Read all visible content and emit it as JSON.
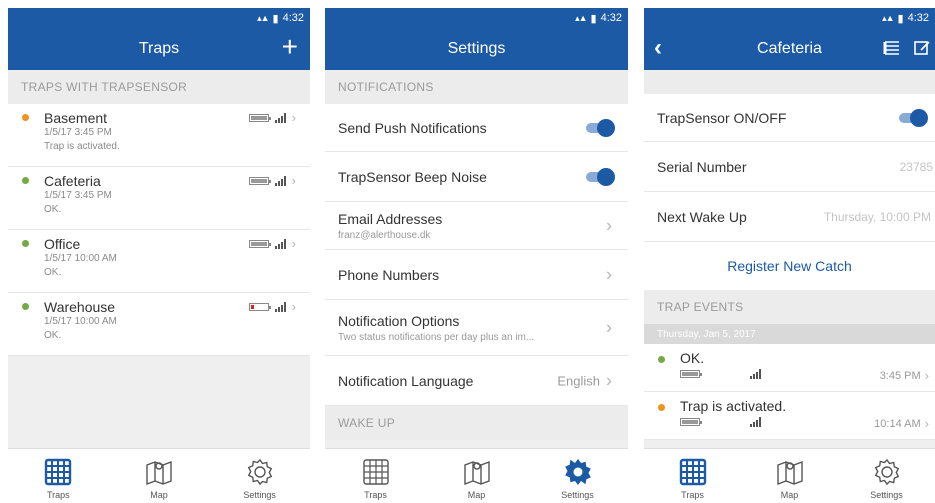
{
  "colors": {
    "primary": "#1d5aa6",
    "dot_orange": "#f0921c",
    "dot_green": "#74aa42",
    "battery_low": "#e02020"
  },
  "status_bar": {
    "time": "4:32"
  },
  "screen1": {
    "title": "Traps",
    "add_icon": "plus-icon",
    "section": "TRAPS WITH TRAPSENSOR",
    "traps": [
      {
        "name": "Basement",
        "time": "1/5/17 3:45 PM",
        "status": "Trap is activated.",
        "dot": "orange",
        "battery": 0.9
      },
      {
        "name": "Cafeteria",
        "time": "1/5/17 3:45 PM",
        "status": "OK.",
        "dot": "green",
        "battery": 0.9
      },
      {
        "name": "Office",
        "time": "1/5/17 10:00 AM",
        "status": "OK.",
        "dot": "green",
        "battery": 0.9
      },
      {
        "name": "Warehouse",
        "time": "1/5/17 10:00 AM",
        "status": "OK.",
        "dot": "green",
        "battery": 0.15
      }
    ]
  },
  "screen2": {
    "title": "Settings",
    "section_notifications": "NOTIFICATIONS",
    "push": "Send Push Notifications",
    "beep": "TrapSensor Beep Noise",
    "email_label": "Email Addresses",
    "email_value": "franz@alerthouse.dk",
    "phone_label": "Phone Numbers",
    "options_label": "Notification Options",
    "options_value": "Two status notifications per day plus an im...",
    "language_label": "Notification Language",
    "language_value": "English",
    "section_wake": "WAKE UP"
  },
  "screen3": {
    "title": "Cafeteria",
    "onoff_label": "TrapSensor ON/OFF",
    "serial_label": "Serial Number",
    "serial_value": "23785",
    "wake_label": "Next Wake Up",
    "wake_value": "Thursday, 10:00 PM",
    "register": "Register New Catch",
    "section_events": "TRAP EVENTS",
    "date_strip": "Thursday, Jan 5, 2017",
    "events": [
      {
        "text": "OK.",
        "time": "3:45 PM",
        "dot": "green"
      },
      {
        "text": "Trap is activated.",
        "time": "10:14 AM",
        "dot": "orange"
      }
    ]
  },
  "tabs": {
    "traps": "Traps",
    "map": "Map",
    "settings": "Settings"
  }
}
